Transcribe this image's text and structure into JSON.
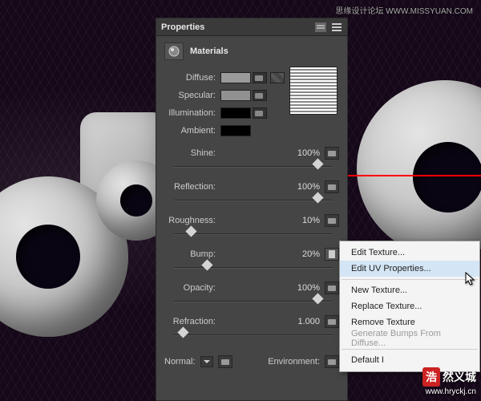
{
  "watermark": {
    "top": "思缘设计论坛  WWW.MISSYUAN.COM",
    "logo": "浩",
    "brand": "然义城",
    "url": "www.hryckj.cn"
  },
  "panel": {
    "title": "Properties",
    "section": "Materials",
    "labels": {
      "diffuse": "Diffuse:",
      "specular": "Specular:",
      "illumination": "Illumination:",
      "ambient": "Ambient:"
    },
    "colors": {
      "diffuse": "#9a9a9a",
      "specular": "#919191",
      "illumination": "#000000",
      "ambient": "#000000"
    },
    "sliders": {
      "shine": {
        "label": "Shine:",
        "value": "100%",
        "pos": 90
      },
      "reflection": {
        "label": "Reflection:",
        "value": "100%",
        "pos": 90
      },
      "roughness": {
        "label": "Roughness:",
        "value": "10%",
        "pos": 10
      },
      "bump": {
        "label": "Bump:",
        "value": "20%",
        "pos": 20
      },
      "opacity": {
        "label": "Opacity:",
        "value": "100%",
        "pos": 90
      },
      "refraction": {
        "label": "Refraction:",
        "value": "1.000",
        "pos": 5
      }
    },
    "bottom": {
      "normal": "Normal:",
      "env": "Environment:"
    }
  },
  "context": {
    "editTexture": "Edit Texture...",
    "editUV": "Edit UV Properties...",
    "newTexture": "New Texture...",
    "replaceTexture": "Replace Texture...",
    "removeTexture": "Remove Texture",
    "genBumps": "Generate Bumps From Diffuse...",
    "default": "Default I"
  }
}
